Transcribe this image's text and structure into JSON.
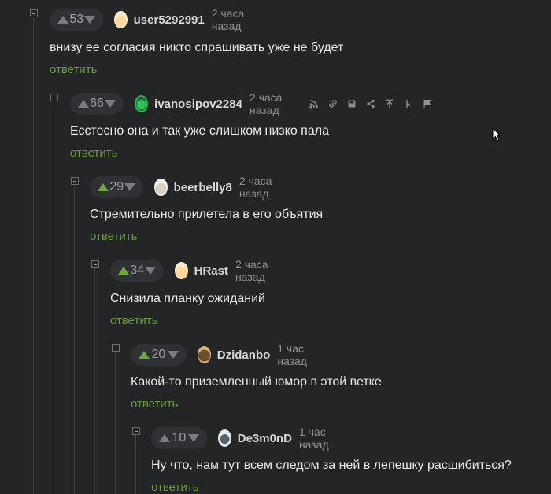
{
  "colors": {
    "background": "#232527",
    "reply_link": "#6a9a3f",
    "upvote_active": "#6ca93b",
    "thread_line": "#3b3e41"
  },
  "comments": [
    {
      "score": "53",
      "user": "user5292991",
      "time": "2 часа назад",
      "text": "внизу ее согласия никто спрашивать уже не будет",
      "reply": "ответить",
      "avatar": "fox-avatar"
    },
    {
      "score": "66",
      "user": "ivanosipov2284",
      "time": "2 часа назад",
      "text": "Есстесно она и так уже слишком низко пала",
      "reply": "ответить",
      "avatar": "green-circle-avatar"
    },
    {
      "score": "29",
      "user": "beerbelly8",
      "time": "2 часа назад",
      "text": "Стремительно прилетела в его объятия",
      "reply": "ответить",
      "avatar": "bear-avatar"
    },
    {
      "score": "34",
      "user": "HRast",
      "time": "2 часа назад",
      "text": "Снизила планку ожиданий",
      "reply": "ответить",
      "avatar": "fox-avatar"
    },
    {
      "score": "20",
      "user": "Dzidanbo",
      "time": "1 час назад",
      "text": "Какой-то приземленный юмор в этой ветке",
      "reply": "ответить",
      "avatar": "dog-avatar"
    },
    {
      "score": "10",
      "user": "De3m0nD",
      "time": "1 час назад",
      "text": "Ну что, нам тут всем следом за ней в лепешку расшибиться?",
      "reply": "ответить",
      "avatar": "car-avatar"
    }
  ],
  "tool_icons": [
    "link-tree-icon",
    "link-icon",
    "save-icon",
    "share-icon",
    "jump-up-icon",
    "branch-icon",
    "report-flag-icon"
  ]
}
